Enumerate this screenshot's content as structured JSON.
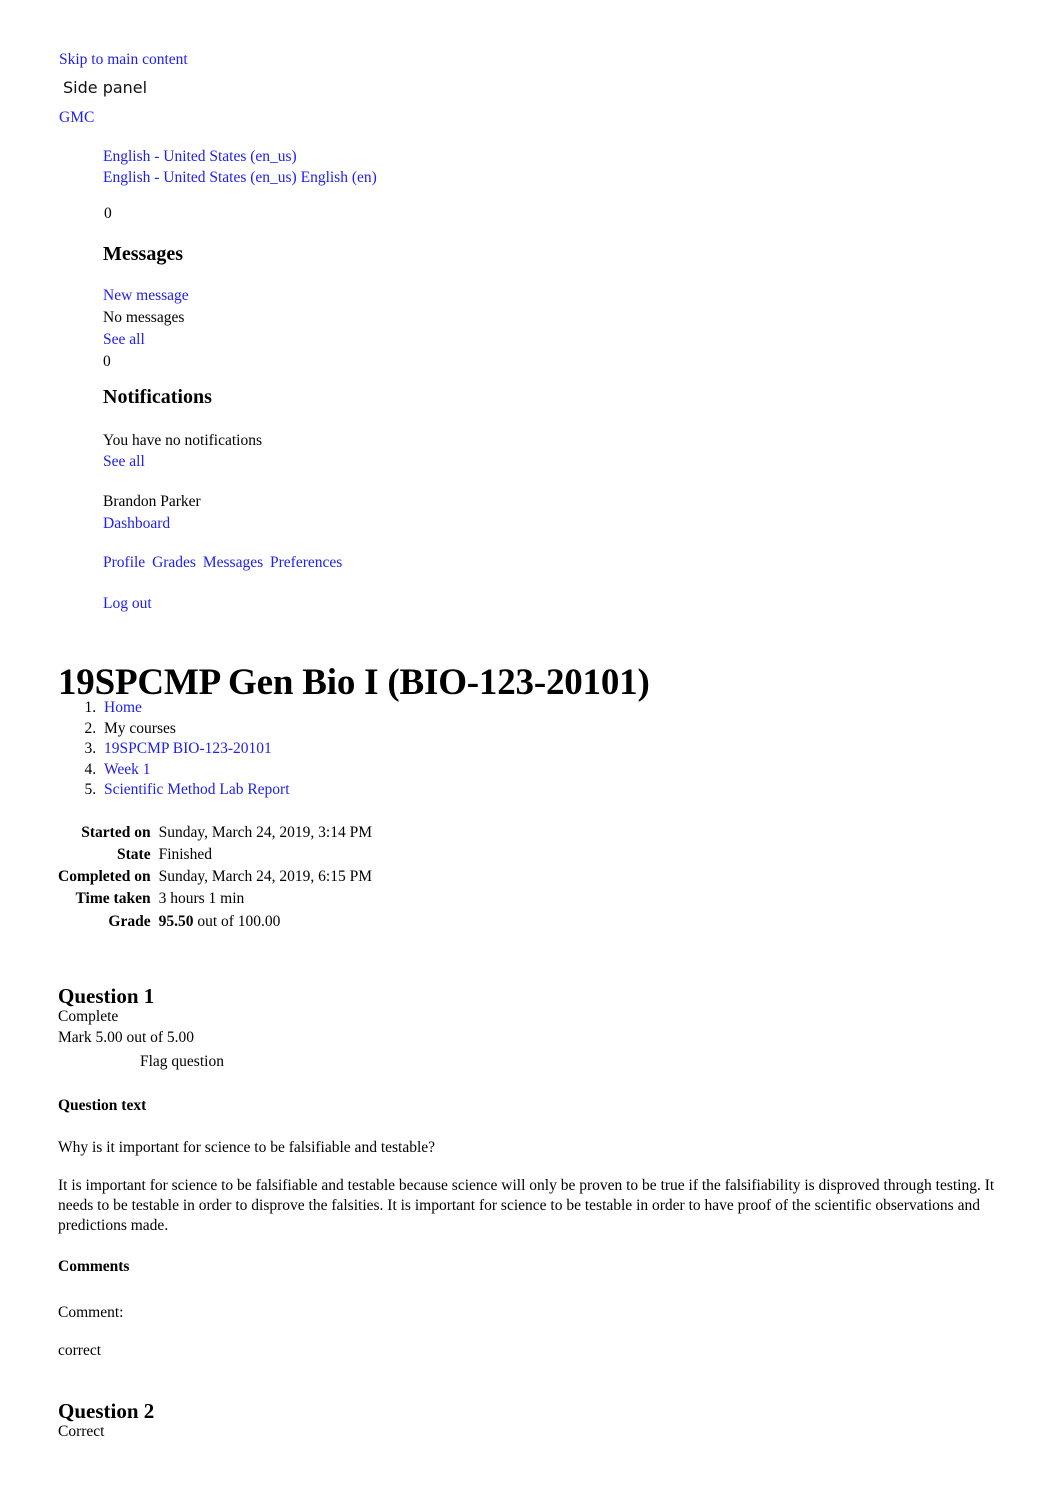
{
  "utility": {
    "skip_link": "Skip to main content",
    "side_panel": "Side panel",
    "brand": "GMC",
    "language": {
      "current": "English - United States (en_us)",
      "options_line": "English - United States (en_us) English (en)"
    },
    "messages": {
      "count": "0",
      "heading": "Messages",
      "new_message": "New message",
      "empty": "No messages",
      "see_all": "See all"
    },
    "notifications": {
      "count": "0",
      "heading": "Notifications",
      "empty": "You have no notifications",
      "see_all": "See all"
    },
    "user": {
      "name": "Brandon Parker",
      "dashboard": "Dashboard",
      "profile": "Profile",
      "grades": "Grades",
      "messages": "Messages",
      "preferences": "Preferences",
      "logout": "Log out"
    }
  },
  "page": {
    "course_title": "19SPCMP Gen Bio I (BIO-123-20101)",
    "breadcrumb": [
      {
        "label": "Home",
        "is_link": true
      },
      {
        "label": "My  courses",
        "is_link": false
      },
      {
        "label": "19SPCMP BIO-123-20101",
        "is_link": true
      },
      {
        "label": "Week 1",
        "is_link": true
      },
      {
        "label": "Scientific Method Lab Report",
        "is_link": true
      }
    ]
  },
  "attempt": {
    "rows": [
      {
        "label": "Started on",
        "value": "Sunday, March 24, 2019, 3:14 PM"
      },
      {
        "label": "State",
        "value": "Finished"
      },
      {
        "label": "Completed on",
        "value": "Sunday, March 24, 2019, 6:15 PM"
      },
      {
        "label": "Time taken",
        "value": "3 hours 1 min"
      }
    ],
    "grade_label": "Grade",
    "grade_value": "95.50",
    "grade_suffix": "out of 100.00"
  },
  "questions": [
    {
      "heading": "Question 1",
      "state": "Complete",
      "mark": "Mark 5.00 out of 5.00",
      "flag": "Flag question",
      "question_text_label": "Question text",
      "prompt": "Why is it important for science to be falsifiable and testable?",
      "answer": "It is important for science to be falsifiable and testable because science will only be proven to be true if the falsifiability is disproved through testing. It needs to be testable in order to disprove the falsities. It is important for science to be testable in order to have proof of the scientific observations and predictions made.",
      "comments_heading": "Comments",
      "comment_label": "Comment:",
      "comment_text": "correct"
    },
    {
      "heading": "Question 2",
      "state": "Correct"
    }
  ],
  "colors": {
    "link": "#2020EE",
    "text": "#000000",
    "background": "#ffffff"
  }
}
